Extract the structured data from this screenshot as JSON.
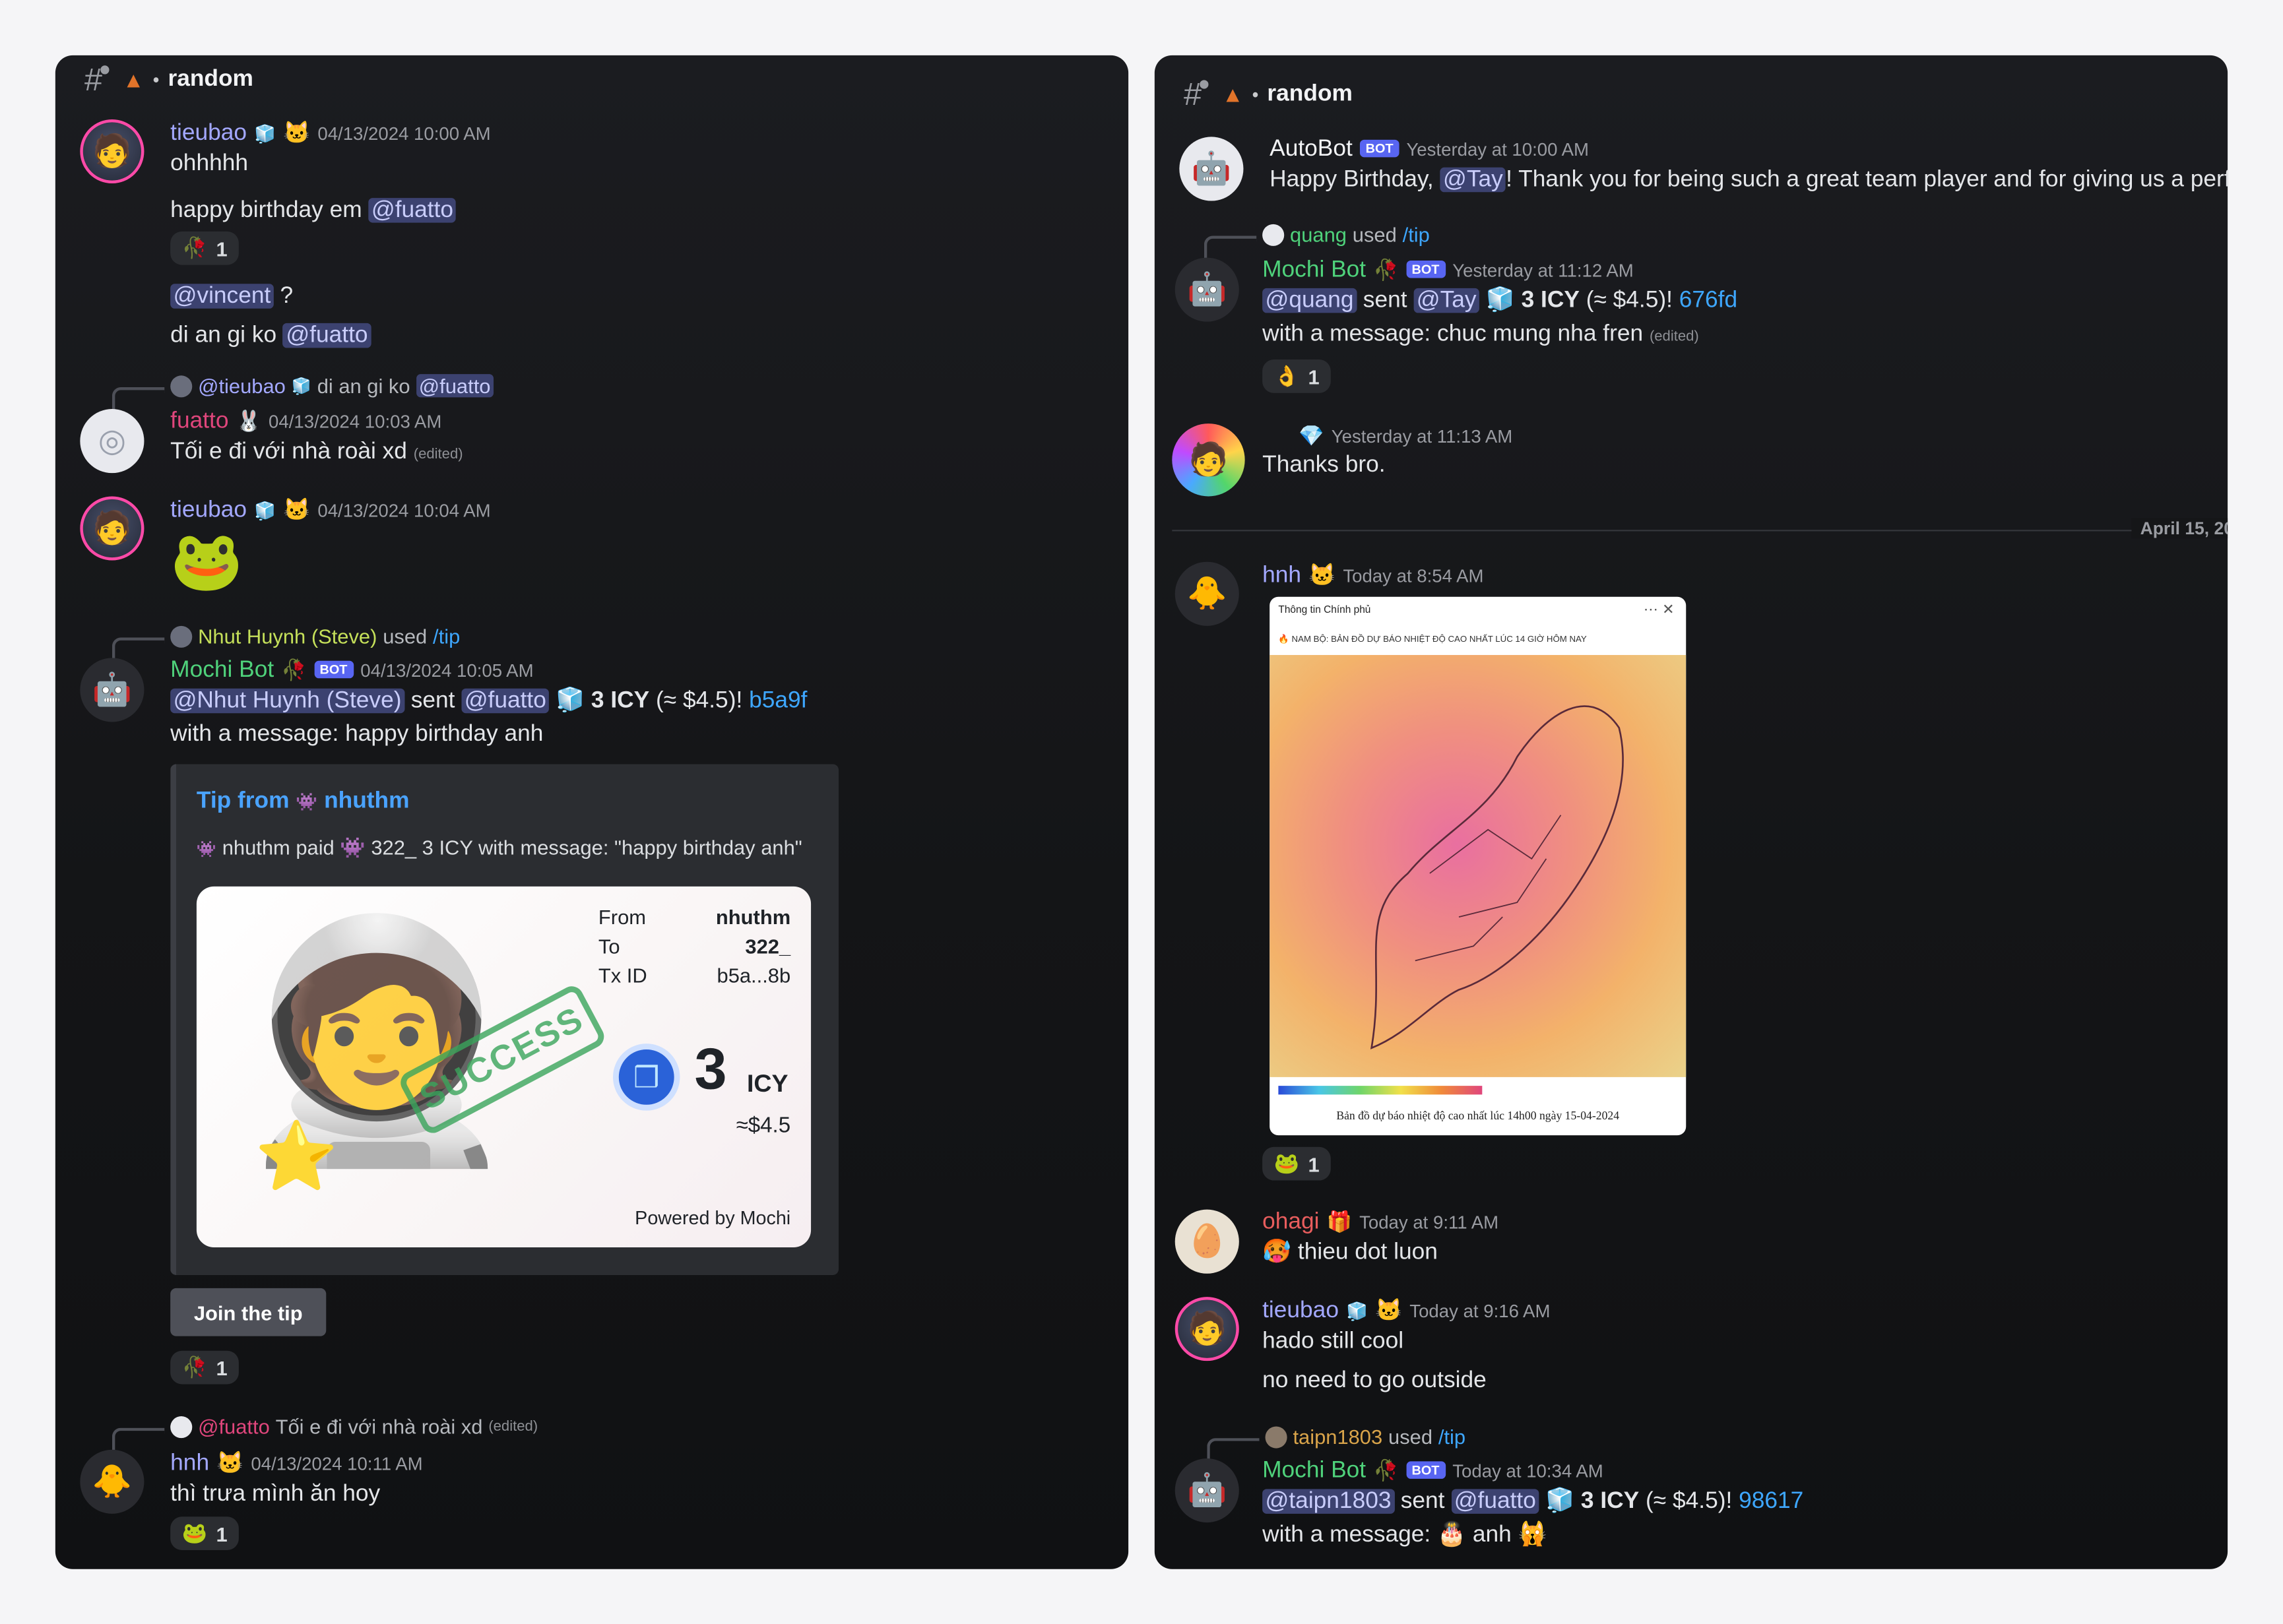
{
  "left": {
    "channel": "random",
    "messages": [
      {
        "user": "tieubao",
        "time": "04/13/2024 10:00 AM",
        "lines": [
          "ohhhhh"
        ]
      },
      {
        "text_before": "happy birthday em",
        "mention": "@fuatto"
      },
      {
        "reaction_count": "1"
      },
      {
        "mention": "@vincent",
        "text_after": "?"
      },
      {
        "text_before": "di an gi ko",
        "mention": "@fuatto"
      }
    ],
    "reply1": {
      "user": "@tieubao",
      "text": "di an gi ko",
      "mention": "@fuatto"
    },
    "fuatto_msg": {
      "user": "fuatto",
      "time": "04/13/2024 10:03 AM",
      "text": "Tối e đi với nhà roài xd",
      "edited": "(edited)"
    },
    "tieubao2": {
      "user": "tieubao",
      "time": "04/13/2024 10:04 AM"
    },
    "reply2": {
      "user": "Nhut Huynh (Steve)",
      "used": "used",
      "cmd": "/tip"
    },
    "mochi1": {
      "user": "Mochi Bot",
      "bot": "BOT",
      "time": "04/13/2024 10:05 AM",
      "sender": "@Nhut Huynh (Steve)",
      "sent": "sent",
      "recipient": "@fuatto",
      "amount": "3 ICY",
      "usd": "(≈ $4.5)!",
      "tx": "b5a9f",
      "message": "with a message: happy birthday anh"
    },
    "embed": {
      "title_prefix": "Tip from",
      "title_user": "nhuthm",
      "desc": "nhuthm paid 👾 322_ 3 ICY with message: \"happy birthday anh\"",
      "card": {
        "from_label": "From",
        "from": "nhuthm",
        "to_label": "To",
        "to": "322_",
        "tx_label": "Tx ID",
        "tx": "b5a...8b",
        "amount": "3",
        "unit": "ICY",
        "usd": "≈$4.5",
        "powered": "Powered by Mochi",
        "stamp": "SUCCESS"
      }
    },
    "join_button": "Join the tip",
    "mochi_reaction": "1",
    "reply3": {
      "user": "@fuatto",
      "text": "Tối e đi với nhà roài xd",
      "edited": "(edited)"
    },
    "hnh_msg": {
      "user": "hnh",
      "time": "04/13/2024 10:11 AM",
      "text": "thì trưa mình ăn hoy",
      "reaction": "1"
    }
  },
  "right": {
    "channel": "random",
    "autobot": {
      "user": "AutoBot",
      "bot": "BOT",
      "time": "Yesterday at 10:00 AM",
      "text_before": "Happy Birthday,",
      "mention": "@Tay",
      "text_after": "! Thank you for being such a great team player and for giving us a perfe"
    },
    "reply1": {
      "user": "quang",
      "used": "used",
      "cmd": "/tip"
    },
    "mochi1": {
      "user": "Mochi Bot",
      "bot": "BOT",
      "time": "Yesterday at 11:12 AM",
      "sender": "@quang",
      "sent": "sent",
      "recipient": "@Tay",
      "amount": "3 ICY",
      "usd": "(≈ $4.5)!",
      "tx": "676fd",
      "message": "with a message: chuc mung nha fren",
      "edited": "(edited)",
      "reaction": "1"
    },
    "thanks": {
      "time": "Yesterday at 11:13 AM",
      "text": "Thanks bro."
    },
    "date_divider": "April 15, 20",
    "hnh": {
      "user": "hnh",
      "time": "Today at 8:54 AM",
      "reaction": "1",
      "image_header": "Thông tin Chính phủ",
      "image_title": "🔥 NAM BỘ: BẢN ĐỒ DỰ BÁO NHIỆT ĐỘ CAO NHẤT LÚC 14 GIỜ HÔM NAY",
      "image_caption": "Bản đồ dự báo nhiệt độ cao nhất lúc 14h00 ngày 15-04-2024"
    },
    "ohagi": {
      "user": "ohagi",
      "time": "Today at 9:11 AM",
      "text": "thieu dot luon"
    },
    "tieubao": {
      "user": "tieubao",
      "time": "Today at 9:16 AM",
      "line1": "hado still cool",
      "line2": "no need to go outside"
    },
    "reply2": {
      "user": "taipn1803",
      "used": "used",
      "cmd": "/tip"
    },
    "mochi2": {
      "user": "Mochi Bot",
      "bot": "BOT",
      "time": "Today at 10:34 AM",
      "sender": "@taipn1803",
      "sent": "sent",
      "recipient": "@fuatto",
      "amount": "3 ICY",
      "usd": "(≈ $4.5)!",
      "tx": "98617",
      "message": "with a message:",
      "message_tail": "anh"
    }
  },
  "colors": {
    "tieubao": "#a3a8ff",
    "fuatto": "#e0467c",
    "mochi": "#4fd27b",
    "hnh": "#a3a8ff",
    "ohagi": "#e85d5d",
    "link": "#3ea7ff",
    "mention_bg": "#3c4270"
  }
}
